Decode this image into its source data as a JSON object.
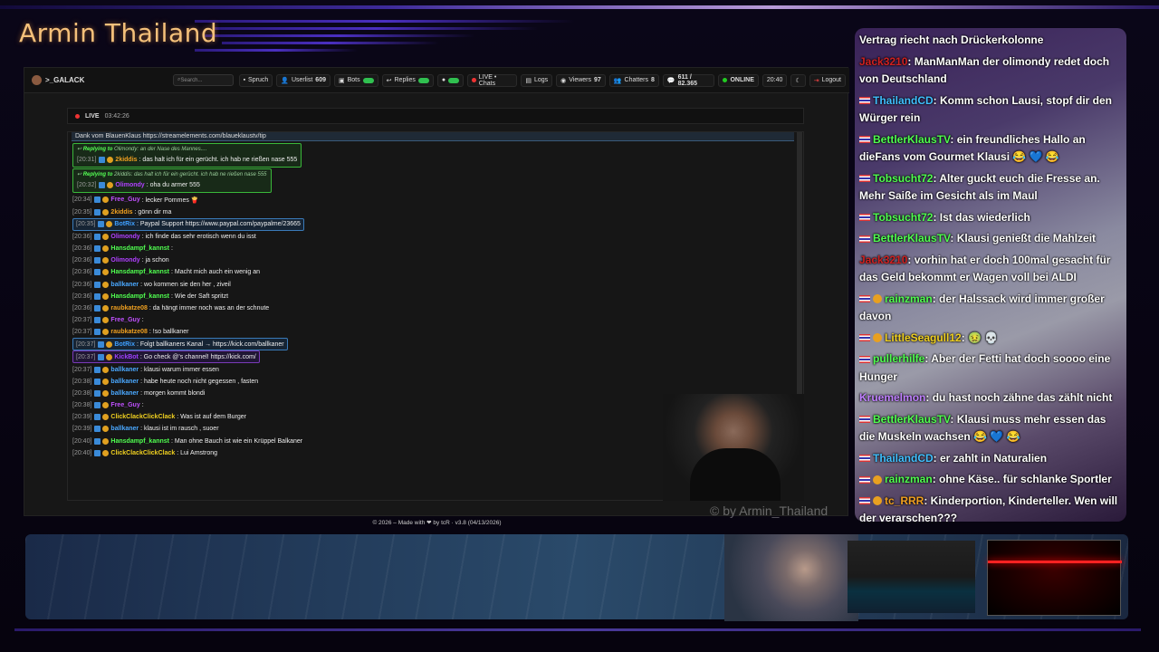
{
  "overlay": {
    "title": "Armin Thailand",
    "watermark": "© by Armin_Thailand"
  },
  "nav": {
    "brand": ">_GALACK",
    "search_placeholder": "Search...",
    "items": [
      {
        "label": "Spruch"
      },
      {
        "label": "Userlist",
        "count": "609"
      },
      {
        "label": "Bots"
      },
      {
        "label": "Replies"
      },
      {
        "label": "LIVE • Chats"
      },
      {
        "label": "Logs"
      },
      {
        "label": "Viewers",
        "count": "97"
      },
      {
        "label": "Chatters",
        "count": "8"
      },
      {
        "label": "611 / 82.365"
      },
      {
        "label": "ONLINE"
      },
      {
        "label": "20:40"
      },
      {
        "label": "Logout"
      }
    ]
  },
  "live": {
    "label": "LIVE",
    "time": "03:42:26"
  },
  "pinned": "Dank vom BlauenKlaus https://streamelements.com/blaueklaustv/tip",
  "chat": [
    {
      "reply_to": "Replying to",
      "reply_user": "Olimondy",
      "reply_text": ": an der Nase des Mannes....",
      "ts": "[20:31]",
      "user": "2kiddis",
      "color": "#f0a020",
      "text": ": das halt ich für ein gerücht. ich hab ne rießen nase 555"
    },
    {
      "reply_to": "Replying to",
      "reply_user": "2kiddis",
      "reply_text": ": das halt ich für ein gerücht. ich hab ne rießen nase 555",
      "ts": "[20:32]",
      "user": "Olimondy",
      "color": "#b040ff",
      "text": ": oha du armer 555"
    },
    {
      "ts": "[20:34]",
      "user": "Free_Guy",
      "color": "#c050ff",
      "text": ": lecker Pommes 🍟"
    },
    {
      "ts": "[20:35]",
      "user": "2kiddis",
      "color": "#f0a020",
      "text": ": gönn dir ma"
    },
    {
      "ts": "[20:35]",
      "user": "BotRix",
      "color": "#40a0ff",
      "text": ": Paypal Support https://www.paypal.com/paypalme/23665",
      "hl": "blue"
    },
    {
      "ts": "[20:36]",
      "user": "Olimondy",
      "color": "#b040ff",
      "text": ": ich finde das sehr erotisch wenn du isst"
    },
    {
      "ts": "[20:36]",
      "user": "Hansdampf_kannst",
      "color": "#50ff50",
      "text": ":"
    },
    {
      "ts": "[20:36]",
      "user": "Olimondy",
      "color": "#b040ff",
      "text": ": ja schon"
    },
    {
      "ts": "[20:36]",
      "user": "Hansdampf_kannst",
      "color": "#50ff50",
      "text": ": Macht mich auch ein wenig an"
    },
    {
      "ts": "[20:36]",
      "user": "ballkaner",
      "color": "#4aa8ff",
      "text": ": wo kommen sie den her , ziveil"
    },
    {
      "ts": "[20:36]",
      "user": "Hansdampf_kannst",
      "color": "#50ff50",
      "text": ": Wie der Saft spritzt"
    },
    {
      "ts": "[20:36]",
      "user": "raubkatze08",
      "color": "#f0a020",
      "text": ": da hängt immer noch was an der schnute"
    },
    {
      "ts": "[20:37]",
      "user": "Free_Guy",
      "color": "#c050ff",
      "text": ":"
    },
    {
      "ts": "[20:37]",
      "user": "raubkatze08",
      "color": "#f0a020",
      "text": ": !so ballkaner"
    },
    {
      "ts": "[20:37]",
      "user": "BotRix",
      "color": "#40a0ff",
      "text": ": Folgt ballkaners Kanal → https://kick.com/ballkaner",
      "hl": "blue"
    },
    {
      "ts": "[20:37]",
      "user": "KickBot",
      "color": "#a040ff",
      "text": ": Go check @'s channel! https://kick.com/",
      "hl": "purple"
    },
    {
      "ts": "[20:37]",
      "user": "ballkaner",
      "color": "#4aa8ff",
      "text": ": klausi warum immer essen"
    },
    {
      "ts": "[20:38]",
      "user": "ballkaner",
      "color": "#4aa8ff",
      "text": ": habe heute noch nicht gegessen , fasten"
    },
    {
      "ts": "[20:38]",
      "user": "ballkaner",
      "color": "#4aa8ff",
      "text": ": morgen kommt blondi"
    },
    {
      "ts": "[20:38]",
      "user": "Free_Guy",
      "color": "#c050ff",
      "text": ":"
    },
    {
      "ts": "[20:39]",
      "user": "ClickClackClickClack",
      "color": "#f0d020",
      "text": ": Was ist auf dem Burger"
    },
    {
      "ts": "[20:39]",
      "user": "ballkaner",
      "color": "#4aa8ff",
      "text": ": klausi ist im rausch , suoer"
    },
    {
      "ts": "[20:40]",
      "user": "Hansdampf_kannst",
      "color": "#50ff50",
      "text": ": Man ohne Bauch ist wie ein Krüppel Balkaner"
    },
    {
      "ts": "[20:40]",
      "user": "ClickClackClickClack",
      "color": "#f0d020",
      "text": ": Lui Amstrong"
    }
  ],
  "footer": "© 2026 – Made with ❤ by tcR · v3.8 (04/13/2026)",
  "side_chat": [
    {
      "user": "",
      "color": "#fff",
      "text": "Vertrag riecht nach Drückerkolonne",
      "flag": false
    },
    {
      "user": "Jack3210",
      "color": "#d02020",
      "text": ": ManManMan der olimondy redet doch von Deutschland",
      "flag": false
    },
    {
      "user": "ThailandCD",
      "color": "#40c0ff",
      "text": ": Komm schon Lausi, stopf dir den Würger rein",
      "flag": true
    },
    {
      "user": "BettlerKlausTV",
      "color": "#50ff50",
      "text": ": ein freundliches Hallo an dieFans vom Gourmet Klausi 😂 💙 😂",
      "flag": true
    },
    {
      "user": "Tobsucht72",
      "color": "#50ff50",
      "text": ": Alter guckt euch die Fresse an. Mehr Saiße im Gesicht als im Maul",
      "flag": true
    },
    {
      "user": "Tobsucht72",
      "color": "#50ff50",
      "text": ": Ist das wiederlich",
      "flag": true
    },
    {
      "user": "BettlerKlausTV",
      "color": "#50ff50",
      "text": ": Klausi genießt die Mahlzeit",
      "flag": true
    },
    {
      "user": "Jack3210",
      "color": "#d02020",
      "text": ": vorhin hat er doch 100mal gesacht für das Geld bekommt er Wagen voll bei ALDI",
      "flag": false
    },
    {
      "user": "rainzman",
      "color": "#50ff50",
      "text": ": der Halssack wird immer großer davon",
      "flag": true,
      "coin": true
    },
    {
      "user": "LittleSeagull12",
      "color": "#f0d020",
      "text": ": 🤢 💀",
      "flag": true,
      "coin": true
    },
    {
      "user": "pullerhilfe",
      "color": "#50ff50",
      "text": ": Aber der Fetti hat doch soooo eine Hunger",
      "flag": true
    },
    {
      "user": "Kruemelmon",
      "color": "#c080ff",
      "text": ": du hast noch zähne das zählt nicht",
      "flag": false
    },
    {
      "user": "BettlerKlausTV",
      "color": "#50ff50",
      "text": ": Klausi muss mehr essen das die Muskeln wachsen 😂 💙 😂",
      "flag": true
    },
    {
      "user": "ThailandCD",
      "color": "#40c0ff",
      "text": ": er zahlt in Naturalien",
      "flag": true
    },
    {
      "user": "rainzman",
      "color": "#50ff50",
      "text": ": ohne Käse.. für schlanke Sportler",
      "flag": true,
      "coin": true
    },
    {
      "user": "tc_RRR",
      "color": "#f0a020",
      "text": ": Kinderportion, Kinderteller. Wen will der verarschen???",
      "flag": true,
      "coin": true
    }
  ]
}
